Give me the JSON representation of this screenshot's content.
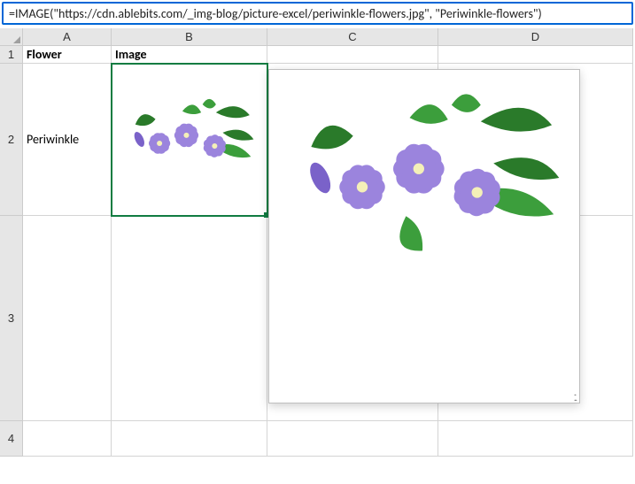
{
  "formula_bar": {
    "value": "=IMAGE(\"https://cdn.ablebits.com/_img-blog/picture-excel/periwinkle-flowers.jpg\", \"Periwinkle-flowers\")"
  },
  "columns": {
    "A": "A",
    "B": "B",
    "C": "C",
    "D": "D"
  },
  "rows": {
    "r1": "1",
    "r2": "2",
    "r3": "3",
    "r4": "4"
  },
  "headers": {
    "A1": "Flower",
    "B1": "Image"
  },
  "cells": {
    "A2": "Periwinkle"
  },
  "image_alt": "Periwinkle-flowers",
  "colors": {
    "petal": "#9b84dd",
    "petal_dark": "#7a62c9",
    "leaf": "#3c9e3c",
    "leaf_dark": "#2a7a2a"
  }
}
